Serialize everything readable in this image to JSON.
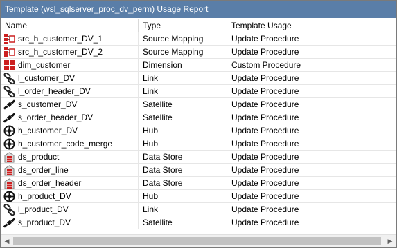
{
  "window": {
    "title": "Template (wsl_sqlserver_proc_dv_perm) Usage Report"
  },
  "columns": {
    "name": "Name",
    "type": "Type",
    "usage": "Template Usage"
  },
  "rows": [
    {
      "name": "src_h_customer_DV_1",
      "type": "Source Mapping",
      "usage": "Update Procedure",
      "icon": "source-mapping-icon"
    },
    {
      "name": "src_h_customer_DV_2",
      "type": "Source Mapping",
      "usage": "Update Procedure",
      "icon": "source-mapping-icon"
    },
    {
      "name": "dim_customer",
      "type": "Dimension",
      "usage": "Custom Procedure",
      "icon": "dimension-icon"
    },
    {
      "name": "l_customer_DV",
      "type": "Link",
      "usage": "Update Procedure",
      "icon": "link-icon"
    },
    {
      "name": "l_order_header_DV",
      "type": "Link",
      "usage": "Update Procedure",
      "icon": "link-icon"
    },
    {
      "name": "s_customer_DV",
      "type": "Satellite",
      "usage": "Update Procedure",
      "icon": "satellite-icon"
    },
    {
      "name": "s_order_header_DV",
      "type": "Satellite",
      "usage": "Update Procedure",
      "icon": "satellite-icon"
    },
    {
      "name": "h_customer_DV",
      "type": "Hub",
      "usage": "Update Procedure",
      "icon": "hub-icon"
    },
    {
      "name": "h_customer_code_merge",
      "type": "Hub",
      "usage": "Update Procedure",
      "icon": "hub-icon"
    },
    {
      "name": "ds_product",
      "type": "Data Store",
      "usage": "Update Procedure",
      "icon": "data-store-icon"
    },
    {
      "name": "ds_order_line",
      "type": "Data Store",
      "usage": "Update Procedure",
      "icon": "data-store-icon"
    },
    {
      "name": "ds_order_header",
      "type": "Data Store",
      "usage": "Update Procedure",
      "icon": "data-store-icon"
    },
    {
      "name": "h_product_DV",
      "type": "Hub",
      "usage": "Update Procedure",
      "icon": "hub-icon"
    },
    {
      "name": "l_product_DV",
      "type": "Link",
      "usage": "Update Procedure",
      "icon": "link-icon"
    },
    {
      "name": "s_product_DV",
      "type": "Satellite",
      "usage": "Update Procedure",
      "icon": "satellite-icon"
    }
  ],
  "colors": {
    "titlebar": "#5a7ea8",
    "icon_red": "#cc1f1f"
  }
}
